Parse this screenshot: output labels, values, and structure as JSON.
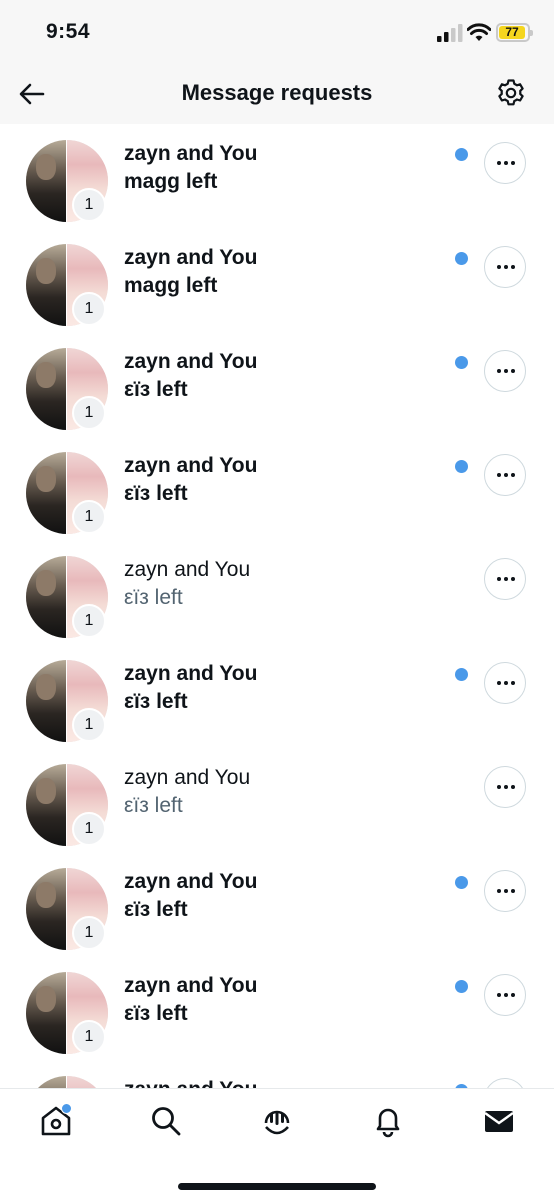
{
  "status_bar": {
    "time": "9:54",
    "battery": "77"
  },
  "header": {
    "title": "Message requests"
  },
  "conversations": [
    {
      "name": "zayn and You",
      "preview": "magg left",
      "count": "1",
      "unread": true
    },
    {
      "name": "zayn and You",
      "preview": "magg left",
      "count": "1",
      "unread": true
    },
    {
      "name": "zayn and You",
      "preview": "εïз left",
      "count": "1",
      "unread": true
    },
    {
      "name": "zayn and You",
      "preview": "εïз left",
      "count": "1",
      "unread": true
    },
    {
      "name": "zayn and You",
      "preview": "εïз left",
      "count": "1",
      "unread": false
    },
    {
      "name": "zayn and You",
      "preview": "εïз left",
      "count": "1",
      "unread": true
    },
    {
      "name": "zayn and You",
      "preview": "εïз left",
      "count": "1",
      "unread": false
    },
    {
      "name": "zayn and You",
      "preview": "εïз left",
      "count": "1",
      "unread": true
    },
    {
      "name": "zayn and You",
      "preview": "εïз left",
      "count": "1",
      "unread": true
    },
    {
      "name": "zayn and You",
      "preview": "",
      "count": "",
      "unread": true
    }
  ],
  "nav": {
    "items": [
      "home-icon",
      "search-icon",
      "spaces-icon",
      "bell-icon",
      "mail-icon"
    ],
    "home_has_badge": true
  },
  "colors": {
    "accent": "#4a99e9",
    "text": "#0f1419",
    "muted": "#536471",
    "battery": "#f5d61e"
  }
}
